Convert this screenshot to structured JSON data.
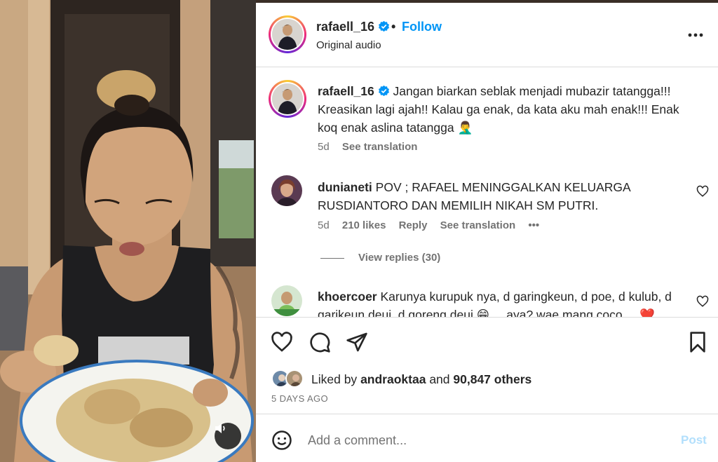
{
  "post": {
    "username": "rafaell_16",
    "follow_label": "Follow",
    "separator": "•",
    "audio_label": "Original audio",
    "caption": "Jangan biarkan seblak menjadi mubazir tatangga!!! Kreasikan lagi ajah!! Kalau ga enak, da kata aku mah enak!!! Enak koq enak aslina tatangga 🤦‍♂️",
    "caption_time": "5d",
    "caption_translate": "See translation"
  },
  "comments": [
    {
      "username": "dunianeti",
      "text": "POV ; RAFAEL MENINGGALKAN KELUARGA RUSDIANTORO DAN MEMILIH NIKAH SM PUTRI.",
      "time": "5d",
      "likes": "210 likes",
      "reply_label": "Reply",
      "translate_label": "See translation",
      "more": "•••",
      "view_replies": "View replies (30)"
    },
    {
      "username": "khoercoer",
      "text": "Karunya kurupuk nya, d garingkeun, d poe, d kulub, d garikeun deui, d goreng deui 😁 ... aya? wae mang coco ... ❤️"
    }
  ],
  "likes": {
    "prefix": "Liked by",
    "user": "andraoktaa",
    "joiner": "and",
    "others": "90,847 others"
  },
  "date_label": "5 DAYS AGO",
  "comment_input": {
    "placeholder": "Add a comment...",
    "post_label": "Post"
  },
  "colors": {
    "accent": "#0095f6",
    "post_disabled": "#b2dffc",
    "muted_text": "#737373",
    "border": "#dbdbdb"
  },
  "icons": [
    "verified-badge-icon",
    "more-options-icon",
    "heart-icon",
    "comment-icon",
    "share-icon",
    "bookmark-icon",
    "emoji-icon",
    "speaker-icon"
  ]
}
